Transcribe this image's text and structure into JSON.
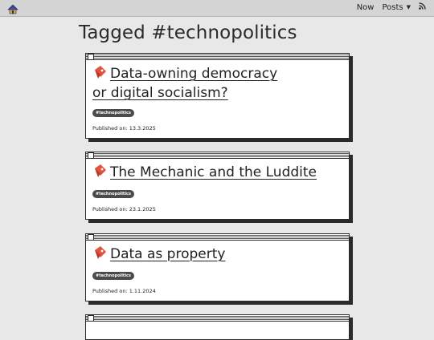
{
  "header": {
    "nav": {
      "now": "Now",
      "posts": "Posts",
      "caret": "▼"
    }
  },
  "page": {
    "title": "Tagged #technopolitics"
  },
  "posts": [
    {
      "title_line1": "Data-owning democracy",
      "title_line2": "or digital socialism?",
      "tag": "#technopolitics",
      "published": "Published on: 13.3.2025"
    },
    {
      "title_line1": "The Mechanic and the Luddite",
      "tag": "#technopolitics",
      "published": "Published on: 23.1.2025"
    },
    {
      "title_line1": "Data as property",
      "tag": "#technopolitics",
      "published": "Published on: 1.11.2024"
    }
  ],
  "colors": {
    "background": "#e8e8e8",
    "topbar": "#d4d4d4",
    "card_border": "#2b2b2b",
    "bookmark": "#e0533d",
    "tag_bg": "#4a4a4a"
  },
  "icons": {
    "logo": "house-logo-icon",
    "bookmark": "bookmark-icon",
    "rss": "rss-icon"
  }
}
